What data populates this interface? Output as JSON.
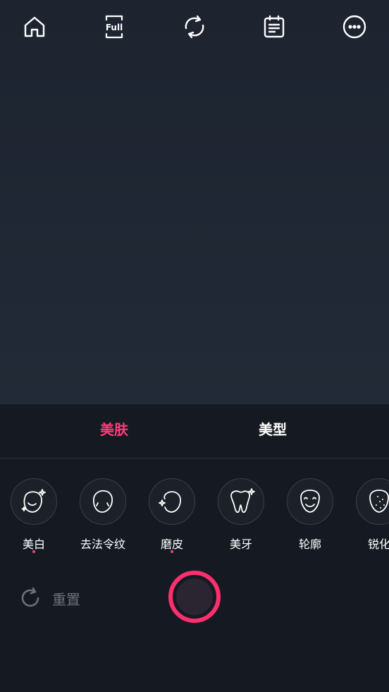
{
  "toolbar": {
    "full_label": "Full",
    "icons": [
      "home-icon",
      "full-screen-icon",
      "switch-camera-icon",
      "notes-icon",
      "more-icon"
    ]
  },
  "tabs": [
    {
      "label": "美肤",
      "active": true
    },
    {
      "label": "美型",
      "active": false
    }
  ],
  "features": [
    {
      "label": "美白",
      "icon": "whitening-face-icon",
      "modified": true
    },
    {
      "label": "去法令纹",
      "icon": "smile-lines-face-icon",
      "modified": false
    },
    {
      "label": "磨皮",
      "icon": "smoothing-face-icon",
      "modified": true
    },
    {
      "label": "美牙",
      "icon": "tooth-icon",
      "modified": false
    },
    {
      "label": "轮廓",
      "icon": "contour-face-icon",
      "modified": false
    },
    {
      "label": "锐化",
      "icon": "sharpen-face-icon",
      "modified": false
    }
  ],
  "reset": {
    "label": "重置"
  },
  "colors": {
    "accent": "#ff3c7a",
    "shutter_ring": "#ff2e6e",
    "panel_bg": "#151a22",
    "preview_bg": "#202733"
  }
}
